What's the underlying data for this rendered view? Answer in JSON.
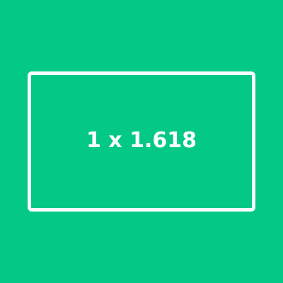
{
  "background_color": "#04c986",
  "frame_color": "#ffffff",
  "text_color": "#ffffff",
  "ratio_label": "1 x 1.618"
}
